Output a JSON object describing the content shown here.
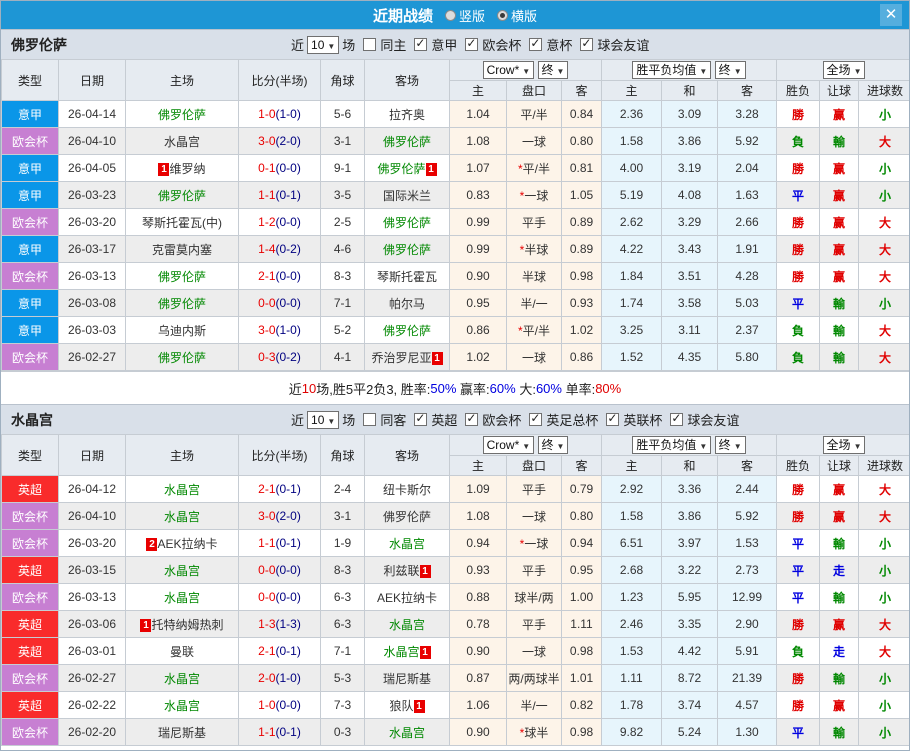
{
  "titlebar": {
    "title": "近期战绩",
    "radios": [
      {
        "label": "竖版",
        "selected": false
      },
      {
        "label": "横版",
        "selected": true
      }
    ],
    "close_icon": "✕"
  },
  "colors": {
    "accent_blue": "#1e96d5",
    "types": {
      "意甲": "#0a96e8",
      "欧会杯": "#c77fd2",
      "英超": "#f92b2b"
    },
    "outcome": {
      "勝": "#e00000",
      "赢": "#e00000",
      "大": "#e00000",
      "負": "#008800",
      "輸": "#008800",
      "小": "#008800",
      "平": "#0000e0",
      "走": "#0000e0"
    },
    "focal_team": "#008800",
    "score": "#e80000",
    "half": "#000080",
    "black": "#222222",
    "red": "#e00000",
    "blue": "#0000e0"
  },
  "table_header": {
    "left_cols": [
      "类型",
      "日期",
      "主场",
      "比分(半场)",
      "角球",
      "客场"
    ],
    "odds_select": "Crow*",
    "odds_final_select": "终",
    "avg_select": "胜平负均值",
    "avg_final_select": "终",
    "scope_select": "全场",
    "odds_sub": [
      "主",
      "盘口",
      "客"
    ],
    "avg_sub": [
      "主",
      "和",
      "客"
    ],
    "result_sub": [
      "胜负",
      "让球",
      "进球数"
    ],
    "caret": "▼"
  },
  "filter_labels": {
    "recent": "近",
    "games": "场"
  },
  "sections": [
    {
      "team": "佛罗伦萨",
      "filters": {
        "recent_value": "10",
        "same_label": "同主",
        "same_checked": false,
        "leagues": [
          "意甲",
          "欧会杯",
          "意杯",
          "球会友谊"
        ]
      },
      "rows": [
        {
          "type": "意甲",
          "date": "26-04-14",
          "home": {
            "name": "佛罗伦萨",
            "focal": true
          },
          "score": "1-0",
          "half": "(1-0)",
          "corners": "5-6",
          "away": {
            "name": "拉齐奥"
          },
          "odds": [
            "1.04",
            "平/半",
            "0.84"
          ],
          "avg": [
            "2.36",
            "3.09",
            "3.28"
          ],
          "outcome": [
            "勝",
            "赢",
            "小"
          ]
        },
        {
          "type": "欧会杯",
          "date": "26-04-10",
          "home": {
            "name": "水晶宫"
          },
          "score": "3-0",
          "half": "(2-0)",
          "corners": "3-1",
          "away": {
            "name": "佛罗伦萨",
            "focal": true
          },
          "odds": [
            "1.08",
            "一球",
            "0.80"
          ],
          "avg": [
            "1.58",
            "3.86",
            "5.92"
          ],
          "outcome": [
            "負",
            "輸",
            "大"
          ]
        },
        {
          "type": "意甲",
          "date": "26-04-05",
          "home": {
            "name": "维罗纳",
            "badge_before": "1"
          },
          "score": "0-1",
          "half": "(0-0)",
          "corners": "9-1",
          "away": {
            "name": "佛罗伦萨",
            "focal": true,
            "badge_after": "1"
          },
          "odds": [
            "1.07",
            "*平/半",
            "0.81"
          ],
          "avg": [
            "4.00",
            "3.19",
            "2.04"
          ],
          "outcome": [
            "勝",
            "赢",
            "小"
          ]
        },
        {
          "type": "意甲",
          "date": "26-03-23",
          "home": {
            "name": "佛罗伦萨",
            "focal": true
          },
          "score": "1-1",
          "half": "(0-1)",
          "corners": "3-5",
          "away": {
            "name": "国际米兰"
          },
          "odds": [
            "0.83",
            "*一球",
            "1.05"
          ],
          "avg": [
            "5.19",
            "4.08",
            "1.63"
          ],
          "outcome": [
            "平",
            "赢",
            "小"
          ]
        },
        {
          "type": "欧会杯",
          "date": "26-03-20",
          "home": {
            "name": "琴斯托霍瓦(中)"
          },
          "score": "1-2",
          "half": "(0-0)",
          "corners": "2-5",
          "away": {
            "name": "佛罗伦萨",
            "focal": true
          },
          "odds": [
            "0.99",
            "平手",
            "0.89"
          ],
          "avg": [
            "2.62",
            "3.29",
            "2.66"
          ],
          "outcome": [
            "勝",
            "赢",
            "大"
          ]
        },
        {
          "type": "意甲",
          "date": "26-03-17",
          "home": {
            "name": "克雷莫内塞"
          },
          "score": "1-4",
          "half": "(0-2)",
          "corners": "4-6",
          "away": {
            "name": "佛罗伦萨",
            "focal": true
          },
          "odds": [
            "0.99",
            "*半球",
            "0.89"
          ],
          "avg": [
            "4.22",
            "3.43",
            "1.91"
          ],
          "outcome": [
            "勝",
            "赢",
            "大"
          ]
        },
        {
          "type": "欧会杯",
          "date": "26-03-13",
          "home": {
            "name": "佛罗伦萨",
            "focal": true
          },
          "score": "2-1",
          "half": "(0-0)",
          "corners": "8-3",
          "away": {
            "name": "琴斯托霍瓦"
          },
          "odds": [
            "0.90",
            "半球",
            "0.98"
          ],
          "avg": [
            "1.84",
            "3.51",
            "4.28"
          ],
          "outcome": [
            "勝",
            "赢",
            "大"
          ]
        },
        {
          "type": "意甲",
          "date": "26-03-08",
          "home": {
            "name": "佛罗伦萨",
            "focal": true
          },
          "score": "0-0",
          "half": "(0-0)",
          "corners": "7-1",
          "away": {
            "name": "帕尔马"
          },
          "odds": [
            "0.95",
            "半/一",
            "0.93"
          ],
          "avg": [
            "1.74",
            "3.58",
            "5.03"
          ],
          "outcome": [
            "平",
            "輸",
            "小"
          ]
        },
        {
          "type": "意甲",
          "date": "26-03-03",
          "home": {
            "name": "乌迪内斯"
          },
          "score": "3-0",
          "half": "(1-0)",
          "corners": "5-2",
          "away": {
            "name": "佛罗伦萨",
            "focal": true
          },
          "odds": [
            "0.86",
            "*平/半",
            "1.02"
          ],
          "avg": [
            "3.25",
            "3.11",
            "2.37"
          ],
          "outcome": [
            "負",
            "輸",
            "大"
          ]
        },
        {
          "type": "欧会杯",
          "date": "26-02-27",
          "home": {
            "name": "佛罗伦萨",
            "focal": true
          },
          "score": "0-3",
          "half": "(0-2)",
          "corners": "4-1",
          "away": {
            "name": "乔治罗尼亚",
            "badge_after": "1"
          },
          "odds": [
            "1.02",
            "一球",
            "0.86"
          ],
          "avg": [
            "1.52",
            "4.35",
            "5.80"
          ],
          "outcome": [
            "負",
            "輸",
            "大"
          ]
        }
      ],
      "summary": [
        {
          "t": "近",
          "c": "black"
        },
        {
          "t": "10",
          "c": "red"
        },
        {
          "t": "场,胜5平2负3, ",
          "c": "black"
        },
        {
          "t": "胜率:",
          "c": "black"
        },
        {
          "t": "50%",
          "c": "blue"
        },
        {
          "t": " 赢率:",
          "c": "black"
        },
        {
          "t": "60%",
          "c": "blue"
        },
        {
          "t": " 大:",
          "c": "black"
        },
        {
          "t": "60%",
          "c": "blue"
        },
        {
          "t": " 单率:",
          "c": "black"
        },
        {
          "t": "80%",
          "c": "red"
        }
      ]
    },
    {
      "team": "水晶宫",
      "filters": {
        "recent_value": "10",
        "same_label": "同客",
        "same_checked": false,
        "leagues": [
          "英超",
          "欧会杯",
          "英足总杯",
          "英联杯",
          "球会友谊"
        ]
      },
      "rows": [
        {
          "type": "英超",
          "date": "26-04-12",
          "home": {
            "name": "水晶宫",
            "focal": true
          },
          "score": "2-1",
          "half": "(0-1)",
          "corners": "2-4",
          "away": {
            "name": "纽卡斯尔"
          },
          "odds": [
            "1.09",
            "平手",
            "0.79"
          ],
          "avg": [
            "2.92",
            "3.36",
            "2.44"
          ],
          "outcome": [
            "勝",
            "赢",
            "大"
          ]
        },
        {
          "type": "欧会杯",
          "date": "26-04-10",
          "home": {
            "name": "水晶宫",
            "focal": true
          },
          "score": "3-0",
          "half": "(2-0)",
          "corners": "3-1",
          "away": {
            "name": "佛罗伦萨"
          },
          "odds": [
            "1.08",
            "一球",
            "0.80"
          ],
          "avg": [
            "1.58",
            "3.86",
            "5.92"
          ],
          "outcome": [
            "勝",
            "赢",
            "大"
          ]
        },
        {
          "type": "欧会杯",
          "date": "26-03-20",
          "home": {
            "name": "AEK拉纳卡",
            "badge_before": "2"
          },
          "score": "1-1",
          "half": "(0-1)",
          "corners": "1-9",
          "away": {
            "name": "水晶宫",
            "focal": true
          },
          "odds": [
            "0.94",
            "*一球",
            "0.94"
          ],
          "avg": [
            "6.51",
            "3.97",
            "1.53"
          ],
          "outcome": [
            "平",
            "輸",
            "小"
          ]
        },
        {
          "type": "英超",
          "date": "26-03-15",
          "home": {
            "name": "水晶宫",
            "focal": true
          },
          "score": "0-0",
          "half": "(0-0)",
          "corners": "8-3",
          "away": {
            "name": "利兹联",
            "badge_after": "1"
          },
          "odds": [
            "0.93",
            "平手",
            "0.95"
          ],
          "avg": [
            "2.68",
            "3.22",
            "2.73"
          ],
          "outcome": [
            "平",
            "走",
            "小"
          ]
        },
        {
          "type": "欧会杯",
          "date": "26-03-13",
          "home": {
            "name": "水晶宫",
            "focal": true
          },
          "score": "0-0",
          "half": "(0-0)",
          "corners": "6-3",
          "away": {
            "name": "AEK拉纳卡"
          },
          "odds": [
            "0.88",
            "球半/两",
            "1.00"
          ],
          "avg": [
            "1.23",
            "5.95",
            "12.99"
          ],
          "outcome": [
            "平",
            "輸",
            "小"
          ]
        },
        {
          "type": "英超",
          "date": "26-03-06",
          "home": {
            "name": "托特纳姆热刺",
            "badge_before": "1"
          },
          "score": "1-3",
          "half": "(1-3)",
          "corners": "6-3",
          "away": {
            "name": "水晶宫",
            "focal": true
          },
          "odds": [
            "0.78",
            "平手",
            "1.11"
          ],
          "avg": [
            "2.46",
            "3.35",
            "2.90"
          ],
          "outcome": [
            "勝",
            "赢",
            "大"
          ]
        },
        {
          "type": "英超",
          "date": "26-03-01",
          "home": {
            "name": "曼联"
          },
          "score": "2-1",
          "half": "(0-1)",
          "corners": "7-1",
          "away": {
            "name": "水晶宫",
            "focal": true,
            "badge_after": "1"
          },
          "odds": [
            "0.90",
            "一球",
            "0.98"
          ],
          "avg": [
            "1.53",
            "4.42",
            "5.91"
          ],
          "outcome": [
            "負",
            "走",
            "大"
          ]
        },
        {
          "type": "欧会杯",
          "date": "26-02-27",
          "home": {
            "name": "水晶宫",
            "focal": true
          },
          "score": "2-0",
          "half": "(1-0)",
          "corners": "5-3",
          "away": {
            "name": "瑞尼斯基"
          },
          "odds": [
            "0.87",
            "两/两球半",
            "1.01"
          ],
          "avg": [
            "1.11",
            "8.72",
            "21.39"
          ],
          "outcome": [
            "勝",
            "輸",
            "小"
          ]
        },
        {
          "type": "英超",
          "date": "26-02-22",
          "home": {
            "name": "水晶宫",
            "focal": true
          },
          "score": "1-0",
          "half": "(0-0)",
          "corners": "7-3",
          "away": {
            "name": "狼队",
            "badge_after": "1"
          },
          "odds": [
            "1.06",
            "半/一",
            "0.82"
          ],
          "avg": [
            "1.78",
            "3.74",
            "4.57"
          ],
          "outcome": [
            "勝",
            "赢",
            "小"
          ]
        },
        {
          "type": "欧会杯",
          "date": "26-02-20",
          "home": {
            "name": "瑞尼斯基"
          },
          "score": "1-1",
          "half": "(0-1)",
          "corners": "0-3",
          "away": {
            "name": "水晶宫",
            "focal": true
          },
          "odds": [
            "0.90",
            "*球半",
            "0.98"
          ],
          "avg": [
            "9.82",
            "5.24",
            "1.30"
          ],
          "outcome": [
            "平",
            "輸",
            "小"
          ]
        }
      ],
      "summary": null
    }
  ]
}
